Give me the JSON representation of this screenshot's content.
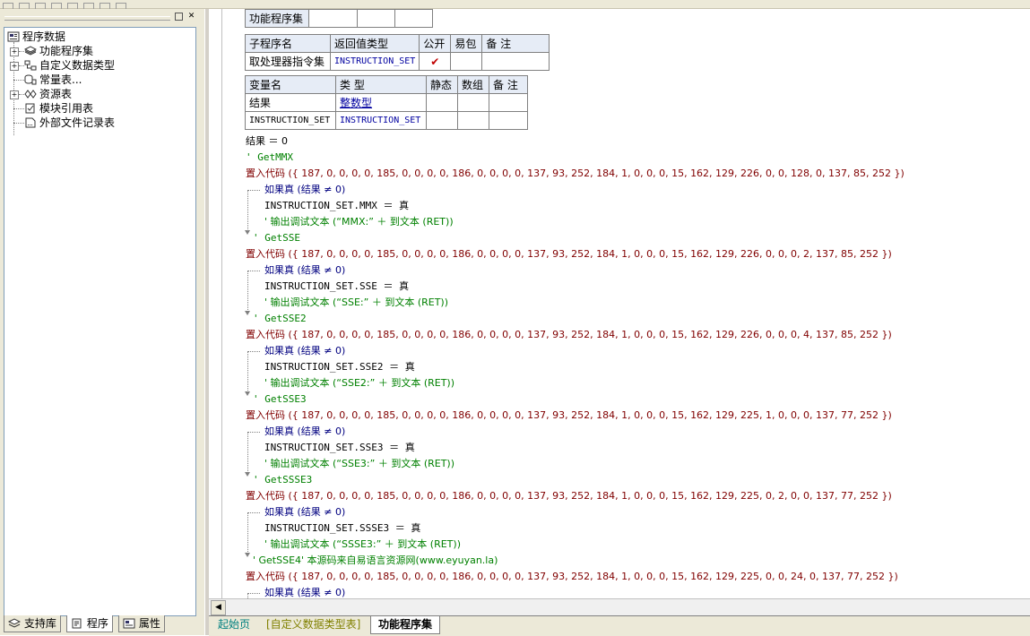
{
  "left_panel": {
    "tree": {
      "root": "程序数据",
      "items": [
        "功能程序集",
        "自定义数据类型",
        "常量表...",
        "资源表",
        "模块引用表",
        "外部文件记录表"
      ]
    },
    "bottom_tabs": [
      "支持库",
      "程序",
      "属性"
    ]
  },
  "assembly_table": {
    "name": "功能程序集"
  },
  "sub_table": {
    "headers": [
      "子程序名",
      "返回值类型",
      "公开",
      "易包",
      "备 注"
    ],
    "row": {
      "name": "取处理器指令集",
      "return_type": "INSTRUCTION_SET",
      "public": "✔",
      "easy_pkg": "",
      "note": ""
    }
  },
  "var_table": {
    "headers": [
      "变量名",
      "类 型",
      "静态",
      "数组",
      "备 注"
    ],
    "rows": [
      {
        "name": "结果",
        "type": "整数型"
      },
      {
        "name": "INSTRUCTION_SET",
        "type": "INSTRUCTION_SET"
      }
    ]
  },
  "code": {
    "init": "结果 ＝ 0",
    "blocks": [
      {
        "comment": "' GetMMX",
        "embed": "置入代码 ({ 187, 0, 0, 0, 0, 185, 0, 0, 0, 0, 186, 0, 0, 0, 0, 137, 93, 252, 184, 1, 0, 0, 0, 15, 162, 129, 226, 0, 0, 128, 0, 137, 85, 252 })",
        "if": "如果真 (结果 ≠ 0)",
        "assign": "INSTRUCTION_SET.MMX ＝ 真",
        "debug": "' 输出调试文本 (“MMX:” ＋ 到文本 (RET))"
      },
      {
        "comment": "' GetSSE",
        "embed": "置入代码 ({ 187, 0, 0, 0, 0, 185, 0, 0, 0, 0, 186, 0, 0, 0, 0, 137, 93, 252, 184, 1, 0, 0, 0, 15, 162, 129, 226, 0, 0, 0, 2, 137, 85, 252 })",
        "if": "如果真 (结果 ≠ 0)",
        "assign": "INSTRUCTION_SET.SSE ＝ 真",
        "debug": "' 输出调试文本 (“SSE:” ＋ 到文本 (RET))"
      },
      {
        "comment": "' GetSSE2",
        "embed": "置入代码 ({ 187, 0, 0, 0, 0, 185, 0, 0, 0, 0, 186, 0, 0, 0, 0, 137, 93, 252, 184, 1, 0, 0, 0, 15, 162, 129, 226, 0, 0, 0, 4, 137, 85, 252 })",
        "if": "如果真 (结果 ≠ 0)",
        "assign": "INSTRUCTION_SET.SSE2 ＝ 真",
        "debug": "' 输出调试文本 (“SSE2:” ＋ 到文本 (RET))"
      },
      {
        "comment": "' GetSSE3",
        "embed": "置入代码 ({ 187, 0, 0, 0, 0, 185, 0, 0, 0, 0, 186, 0, 0, 0, 0, 137, 93, 252, 184, 1, 0, 0, 0, 15, 162, 129, 225, 1, 0, 0, 0, 137, 77, 252 })",
        "if": "如果真 (结果 ≠ 0)",
        "assign": "INSTRUCTION_SET.SSE3 ＝ 真",
        "debug": "' 输出调试文本 (“SSE3:” ＋ 到文本 (RET))"
      },
      {
        "comment": "' GetSSSE3",
        "embed": "置入代码 ({ 187, 0, 0, 0, 0, 185, 0, 0, 0, 0, 186, 0, 0, 0, 0, 137, 93, 252, 184, 1, 0, 0, 0, 15, 162, 129, 225, 0, 2, 0, 0, 137, 77, 252 })",
        "if": "如果真 (结果 ≠ 0)",
        "assign": "INSTRUCTION_SET.SSSE3 ＝ 真",
        "debug": "' 输出调试文本 (“SSSE3:” ＋ 到文本 (RET))"
      },
      {
        "comment": "' GetSSE4' 本源码来自易语言资源网(www.eyuyan.la)",
        "embed": "置入代码 ({ 187, 0, 0, 0, 0, 185, 0, 0, 0, 0, 186, 0, 0, 0, 0, 137, 93, 252, 184, 1, 0, 0, 0, 15, 162, 129, 225, 0, 0, 24, 0, 137, 77, 252 })",
        "if": "如果真 (结果 ≠ 0)"
      }
    ]
  },
  "doc_tabs": [
    "起始页",
    "[自定义数据类型表]",
    "功能程序集"
  ]
}
